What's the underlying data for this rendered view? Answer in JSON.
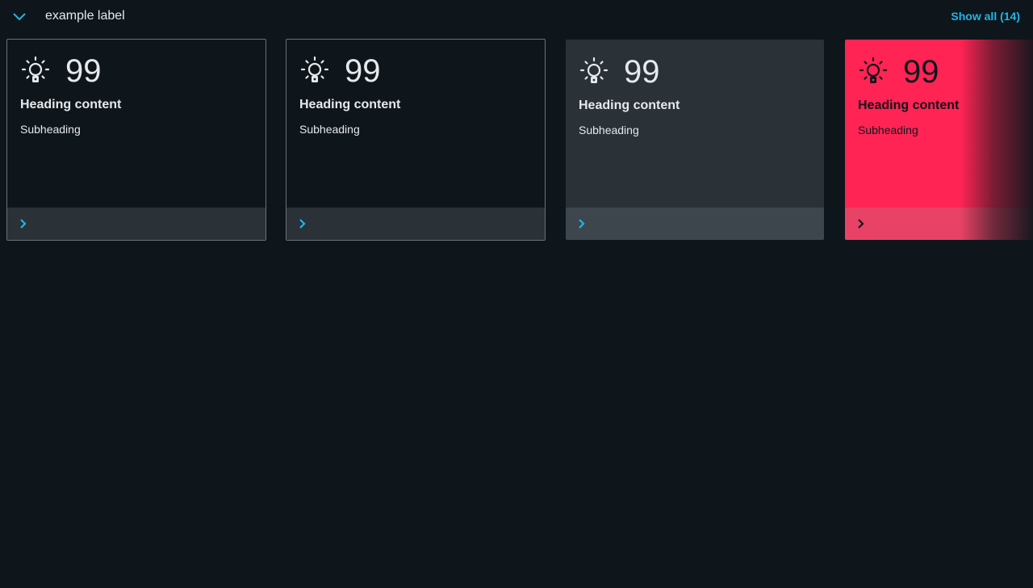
{
  "header": {
    "label": "example label",
    "show_all": "Show all (14)",
    "collapse_icon": "chevron-down-icon"
  },
  "colors": {
    "accent": "#20b4e8",
    "background": "#0f161b",
    "card_filled": "#2a3137",
    "card_alert": "#ff2453"
  },
  "cards": [
    {
      "variant": "outlined",
      "icon": "lightbulb-icon",
      "value": "99",
      "heading": "Heading content",
      "subheading": "Subheading",
      "footer_icon": "chevron-right-icon"
    },
    {
      "variant": "outlined",
      "icon": "lightbulb-icon",
      "value": "99",
      "heading": "Heading content",
      "subheading": "Subheading",
      "footer_icon": "chevron-right-icon"
    },
    {
      "variant": "filled",
      "icon": "lightbulb-icon",
      "value": "99",
      "heading": "Heading content",
      "subheading": "Subheading",
      "footer_icon": "chevron-right-icon"
    },
    {
      "variant": "alert",
      "icon": "lightbulb-icon",
      "value": "99",
      "heading": "Heading content",
      "subheading": "Subheading",
      "footer_icon": "chevron-right-icon"
    }
  ]
}
